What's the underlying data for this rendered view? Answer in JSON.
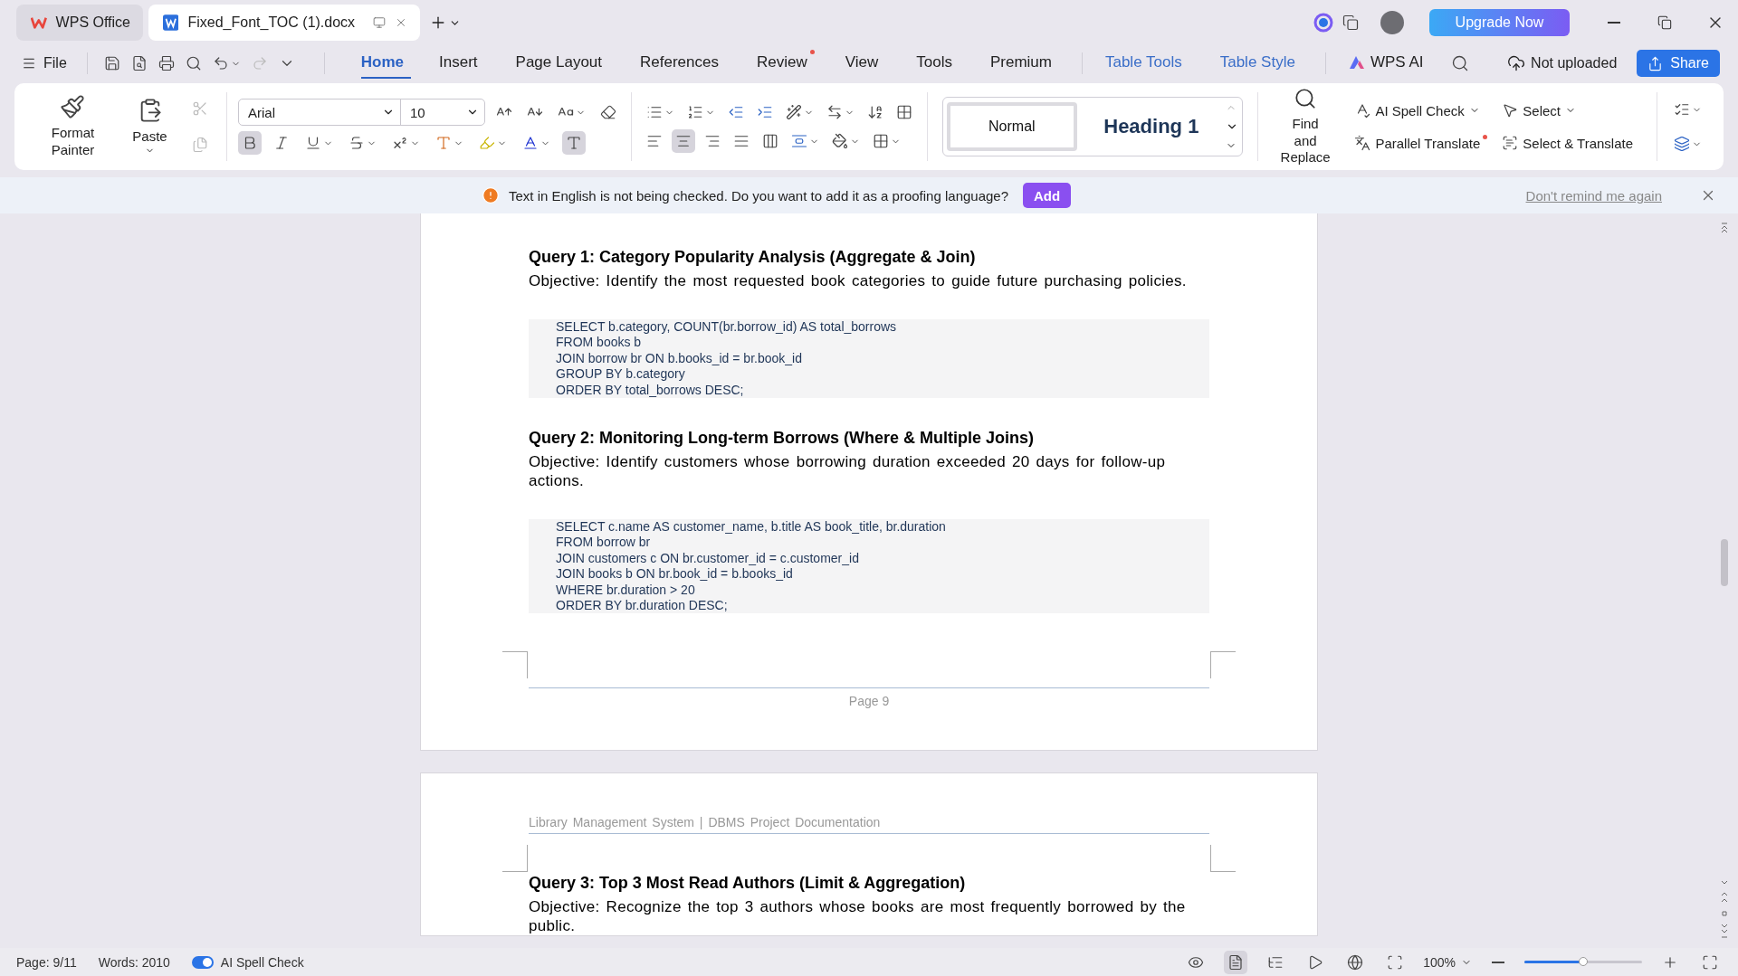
{
  "title_bar": {
    "tabs": [
      {
        "label": "WPS Office",
        "kind": "home",
        "selected": false
      },
      {
        "label": "Fixed_Font_TOC (1).docx",
        "kind": "document",
        "selected": true
      }
    ],
    "upgrade": "Upgrade Now"
  },
  "menu_bar": {
    "file": "File",
    "tabs": [
      {
        "label": "Home",
        "kind": "main",
        "selected": true,
        "badge": false
      },
      {
        "label": "Insert",
        "kind": "main",
        "selected": false,
        "badge": false
      },
      {
        "label": "Page Layout",
        "kind": "main",
        "selected": false,
        "badge": false
      },
      {
        "label": "References",
        "kind": "main",
        "selected": false,
        "badge": false
      },
      {
        "label": "Review",
        "kind": "main",
        "selected": false,
        "badge": true
      },
      {
        "label": "View",
        "kind": "main",
        "selected": false,
        "badge": false
      },
      {
        "label": "Tools",
        "kind": "main",
        "selected": false,
        "badge": false
      },
      {
        "label": "Premium",
        "kind": "main",
        "selected": false,
        "badge": false
      },
      {
        "label": "Table Tools",
        "kind": "context",
        "selected": false,
        "badge": false
      },
      {
        "label": "Table Style",
        "kind": "context",
        "selected": false,
        "badge": false
      },
      {
        "label": "WPS AI",
        "kind": "ai",
        "selected": false,
        "badge": false
      }
    ],
    "cloud_status": "Not uploaded",
    "share": "Share"
  },
  "ribbon": {
    "format_painter": "Format Painter",
    "paste": "Paste",
    "font_name": "Arial",
    "font_size": "10",
    "bold": true,
    "alignment": [
      {
        "kind": "left",
        "selected": false
      },
      {
        "kind": "center",
        "selected": true
      },
      {
        "kind": "right",
        "selected": false
      },
      {
        "kind": "justify",
        "selected": false
      },
      {
        "kind": "distributed",
        "selected": false
      }
    ],
    "styles": [
      {
        "label": "Normal",
        "kind": "normal",
        "selected": true
      },
      {
        "label": "Heading 1",
        "kind": "heading",
        "selected": false
      }
    ],
    "find_replace": "Find and Replace",
    "tools": [
      {
        "label": "AI Spell Check",
        "kind": "spell",
        "dropdown": true,
        "badge": false
      },
      {
        "label": "Select",
        "kind": "select",
        "dropdown": true,
        "badge": false
      },
      {
        "label": "Parallel Translate",
        "kind": "translate",
        "dropdown": false,
        "badge": true
      },
      {
        "label": "Select & Translate",
        "kind": "select-translate",
        "dropdown": false,
        "badge": false
      }
    ]
  },
  "notification": {
    "message": "Text in English is not being checked. Do you want to add it as a proofing language?",
    "action": "Add",
    "dismiss": "Don't remind me again"
  },
  "document": {
    "pages": [
      {
        "footer": "Page 9",
        "blocks": [
          {
            "kind": "heading",
            "text": "Query 1: Category Popularity Analysis (Aggregate & Join)"
          },
          {
            "kind": "paragraph",
            "text": "Objective: Identify the most requested book categories to guide future purchasing policies."
          },
          {
            "kind": "code",
            "lines": [
              "SELECT b.category, COUNT(br.borrow_id) AS total_borrows",
              "FROM books b",
              "JOIN borrow br ON b.books_id = br.book_id",
              "GROUP BY b.category",
              "ORDER BY total_borrows DESC;"
            ]
          },
          {
            "kind": "heading",
            "text": "Query 2: Monitoring Long-term Borrows (Where & Multiple Joins)"
          },
          {
            "kind": "paragraph",
            "text": "Objective: Identify customers whose borrowing duration exceeded 20 days for follow-up actions."
          },
          {
            "kind": "code",
            "lines": [
              "SELECT c.name AS customer_name, b.title AS book_title, br.duration",
              "FROM borrow br",
              "JOIN customers c ON br.customer_id = c.customer_id",
              "JOIN books b ON br.book_id = b.books_id",
              "WHERE br.duration > 20",
              "ORDER BY br.duration DESC;"
            ]
          }
        ]
      },
      {
        "header": "Library Management System | DBMS Project Documentation",
        "blocks": [
          {
            "kind": "heading",
            "text": "Query 3: Top 3 Most Read Authors (Limit & Aggregation)"
          },
          {
            "kind": "paragraph",
            "text": "Objective: Recognize the top 3 authors whose books are most frequently borrowed by the public."
          }
        ]
      }
    ]
  },
  "status_bar": {
    "page": "Page: 9/11",
    "words": "Words: 2010",
    "spell_check": {
      "label": "AI Spell Check",
      "on": true
    },
    "views": [
      {
        "kind": "eye",
        "selected": false
      },
      {
        "kind": "page",
        "selected": true
      },
      {
        "kind": "outline",
        "selected": false
      },
      {
        "kind": "play",
        "selected": false
      },
      {
        "kind": "web",
        "selected": false
      },
      {
        "kind": "fit",
        "selected": false
      }
    ],
    "zoom": {
      "reading": "100%",
      "level": 0.5
    }
  }
}
